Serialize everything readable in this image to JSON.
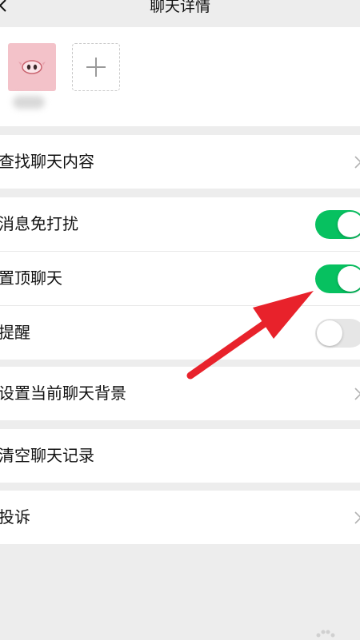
{
  "header": {
    "title": "聊天详情"
  },
  "members": {
    "add_label": "+"
  },
  "rows": {
    "search": {
      "label": "查找聊天内容"
    },
    "mute": {
      "label": "消息免打扰",
      "toggle": "on"
    },
    "sticky": {
      "label": "置顶聊天",
      "toggle": "on"
    },
    "remind": {
      "label": "提醒",
      "toggle": "off"
    },
    "background": {
      "label": "设置当前聊天背景"
    },
    "clear": {
      "label": "清空聊天记录"
    },
    "report": {
      "label": "投诉"
    }
  },
  "colors": {
    "toggle_on": "#07c160",
    "toggle_off": "#e6e6e6",
    "annotation_arrow": "#e8222b",
    "avatar_bg": "#f3c2c9"
  },
  "icons": {
    "back": "chevron-left",
    "row_chevron": "chevron-right",
    "add": "plus",
    "avatar": "pig-face"
  }
}
